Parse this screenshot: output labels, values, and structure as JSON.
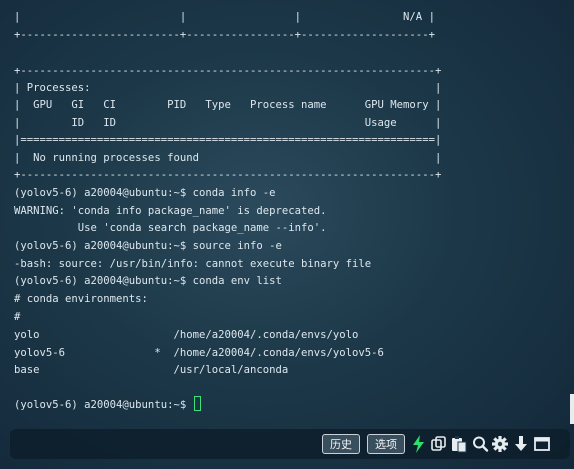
{
  "terminal": {
    "lines": [
      "|                         |                 |                N/A |",
      "+-------------------------+-----------------+--------------------+",
      "",
      "+-----------------------------------------------------------------+",
      "| Processes:                                                      |",
      "|  GPU   GI   CI        PID   Type   Process name      GPU Memory |",
      "|        ID   ID                                       Usage      |",
      "|=================================================================|",
      "|  No running processes found                                     |",
      "+-----------------------------------------------------------------+",
      "(yolov5-6) a20004@ubuntu:~$ conda info -e",
      "WARNING: 'conda info package_name' is deprecated.",
      "          Use 'conda search package_name --info'.",
      "(yolov5-6) a20004@ubuntu:~$ source info -e",
      "-bash: source: /usr/bin/info: cannot execute binary file",
      "(yolov5-6) a20004@ubuntu:~$ conda env list",
      "# conda environments:",
      "#",
      "yolo                     /home/a20004/.conda/envs/yolo",
      "yolov5-6              *  /home/a20004/.conda/envs/yolov5-6",
      "base                     /usr/local/anconda",
      "",
      "(yolov5-6) a20004@ubuntu:~$ "
    ]
  },
  "toolbar": {
    "history_label": "历史",
    "options_label": "选项",
    "icons": [
      "lightning-icon",
      "copy-icon",
      "paste-icon",
      "search-icon",
      "gear-icon",
      "download-icon",
      "window-icon"
    ]
  }
}
